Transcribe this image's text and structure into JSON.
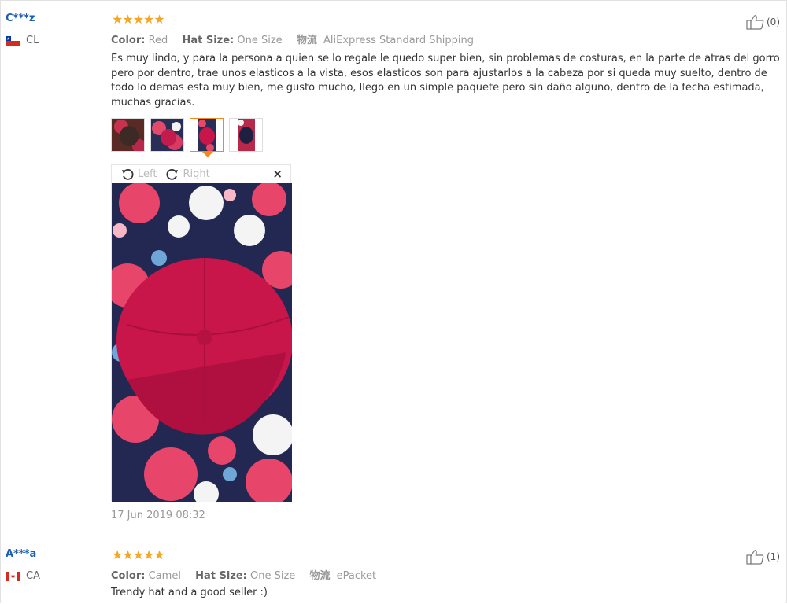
{
  "reviews": [
    {
      "user": "C***z",
      "country": "CL",
      "rating": 5,
      "stars": "★★★★★",
      "attributes": {
        "color_label": "Color:",
        "color_value": "Red",
        "size_label": "Hat Size:",
        "size_value": "One Size",
        "shipping_label": "物流",
        "shipping_value": "AliExpress Standard Shipping"
      },
      "text": "Es muy lindo, y para la persona a quien se lo regale le quedo super bien, sin problemas de costuras, en la parte de atras del gorro pero por dentro, trae unos elasticos a la vista, esos elasticos son para ajustarlos a la cabeza por si queda muy suelto, dentro de todo lo demas esta muy bien, me gusto mucho, llego en un simple paquete pero sin daño alguno, dentro de la fecha estimada, muchas gracias.",
      "likes": "(0)",
      "viewer": {
        "left_label": "Left",
        "right_label": "Right",
        "close_label": "×"
      },
      "date": "17 Jun 2019 08:32"
    },
    {
      "user": "A***a",
      "country": "CA",
      "rating": 5,
      "stars": "★★★★★",
      "attributes": {
        "color_label": "Color:",
        "color_value": "Camel",
        "size_label": "Hat Size:",
        "size_value": "One Size",
        "shipping_label": "物流",
        "shipping_value": "ePacket"
      },
      "text": "Trendy hat and a good seller :)",
      "likes": "(1)"
    }
  ],
  "colors": {
    "user_link": "#1d5fb4",
    "star": "#f5a623",
    "active_thumb": "#f08a1e",
    "hat": "#c8154a"
  },
  "icons": [
    "thumbs-up-icon",
    "rotate-left-icon",
    "rotate-right-icon",
    "close-icon",
    "flag-cl-icon",
    "flag-ca-icon"
  ]
}
